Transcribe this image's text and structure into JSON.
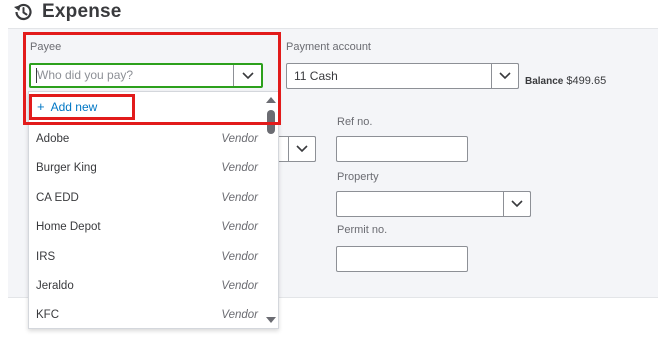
{
  "header": {
    "title": "Expense",
    "icon": "history-icon"
  },
  "payee": {
    "label": "Payee",
    "placeholder": "Who did you pay?",
    "add_new_label": "Add new",
    "vendors": [
      {
        "name": "Adobe",
        "type": "Vendor"
      },
      {
        "name": "Burger King",
        "type": "Vendor"
      },
      {
        "name": "CA EDD",
        "type": "Vendor"
      },
      {
        "name": "Home Depot",
        "type": "Vendor"
      },
      {
        "name": "IRS",
        "type": "Vendor"
      },
      {
        "name": "Jeraldo",
        "type": "Vendor"
      },
      {
        "name": "KFC",
        "type": "Vendor"
      }
    ]
  },
  "payment_account": {
    "label": "Payment account",
    "value": "11 Cash",
    "balance_label": "Balance",
    "balance_value": "$499.65"
  },
  "ref_no": {
    "label": "Ref no.",
    "value": ""
  },
  "property": {
    "label": "Property",
    "value": ""
  },
  "permit_no": {
    "label": "Permit no.",
    "value": ""
  },
  "colors": {
    "accent_green": "#2ca01c",
    "link_blue": "#0077c5",
    "highlight_red": "#e21b1b",
    "panel_bg": "#f4f5f8"
  }
}
